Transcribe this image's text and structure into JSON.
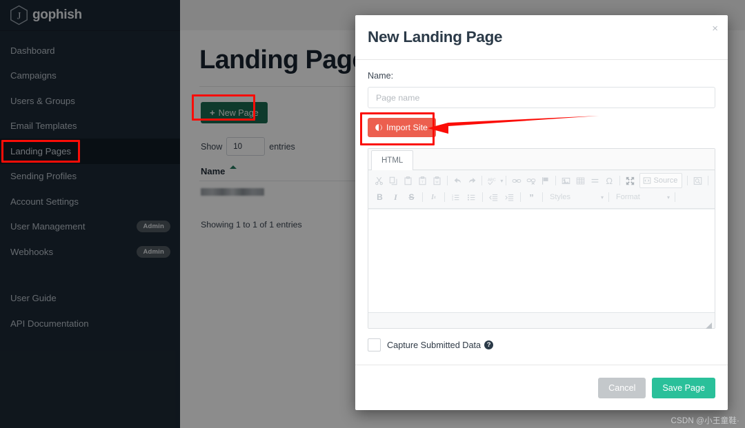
{
  "brand": {
    "name": "gophish",
    "mark": "hexagon-j-icon"
  },
  "sidebar": {
    "items": [
      {
        "label": "Dashboard",
        "badge": "",
        "active": false
      },
      {
        "label": "Campaigns",
        "badge": "",
        "active": false
      },
      {
        "label": "Users & Groups",
        "badge": "",
        "active": false
      },
      {
        "label": "Email Templates",
        "badge": "",
        "active": false
      },
      {
        "label": "Landing Pages",
        "badge": "",
        "active": true
      },
      {
        "label": "Sending Profiles",
        "badge": "",
        "active": false
      },
      {
        "label": "Account Settings",
        "badge": "",
        "active": false
      },
      {
        "label": "User Management",
        "badge": "Admin",
        "active": false
      },
      {
        "label": "Webhooks",
        "badge": "Admin",
        "active": false
      }
    ],
    "footer_items": [
      {
        "label": "User Guide"
      },
      {
        "label": "API Documentation"
      }
    ]
  },
  "main": {
    "page_title": "Landing Pages",
    "new_page_button": "New Page",
    "new_page_plus": "+",
    "show_label": "Show",
    "entries_select_value": "10",
    "entries_label": "entries",
    "table": {
      "columns": [
        "Name"
      ],
      "rows": [
        {
          "name": ""
        }
      ]
    },
    "showing_text": "Showing 1 to 1 of 1 entries"
  },
  "modal": {
    "title": "New Landing Page",
    "close_icon": "×",
    "name_label": "Name:",
    "name_value": "",
    "name_placeholder": "Page name",
    "import_site_button": "Import Site",
    "editor": {
      "tabs": [
        {
          "label": "HTML",
          "active": true
        }
      ],
      "toolbar_row1": [
        {
          "name": "cut-icon",
          "glyph": "cut"
        },
        {
          "name": "copy-icon",
          "glyph": "copy"
        },
        {
          "name": "paste-icon",
          "glyph": "paste"
        },
        {
          "name": "paste-as-text-icon",
          "glyph": "paste-text"
        },
        {
          "name": "paste-from-word-icon",
          "glyph": "paste-word"
        },
        {
          "name": "separator",
          "glyph": "sep"
        },
        {
          "name": "undo-icon",
          "glyph": "undo"
        },
        {
          "name": "redo-icon",
          "glyph": "redo"
        },
        {
          "name": "separator",
          "glyph": "sep"
        },
        {
          "name": "spell-check-icon",
          "glyph": "spell"
        },
        {
          "name": "separator",
          "glyph": "sep"
        },
        {
          "name": "link-icon",
          "glyph": "link"
        },
        {
          "name": "unlink-icon",
          "glyph": "unlink"
        },
        {
          "name": "anchor-flag-icon",
          "glyph": "flag"
        },
        {
          "name": "separator",
          "glyph": "sep"
        },
        {
          "name": "image-icon",
          "glyph": "image"
        },
        {
          "name": "table-icon",
          "glyph": "table"
        },
        {
          "name": "horizontal-rule-icon",
          "glyph": "hrule"
        },
        {
          "name": "special-character-icon",
          "glyph": "omega"
        },
        {
          "name": "separator",
          "glyph": "sep"
        },
        {
          "name": "maximize-icon",
          "glyph": "maximize"
        }
      ],
      "source_button": "Source",
      "toolbar_row1_tail": [
        {
          "name": "separator",
          "glyph": "sep"
        },
        {
          "name": "preview-icon",
          "glyph": "preview"
        },
        {
          "name": "separator",
          "glyph": "sep"
        }
      ],
      "toolbar_row2": [
        {
          "name": "bold-icon",
          "glyph": "B"
        },
        {
          "name": "italic-icon",
          "glyph": "I"
        },
        {
          "name": "strikethrough-icon",
          "glyph": "S"
        },
        {
          "name": "separator",
          "glyph": "sep"
        },
        {
          "name": "remove-format-icon",
          "glyph": "Ix"
        },
        {
          "name": "separator",
          "glyph": "sep"
        },
        {
          "name": "numbered-list-icon",
          "glyph": "ol"
        },
        {
          "name": "bulleted-list-icon",
          "glyph": "ul"
        },
        {
          "name": "separator",
          "glyph": "sep"
        },
        {
          "name": "decrease-indent-icon",
          "glyph": "outdent"
        },
        {
          "name": "increase-indent-icon",
          "glyph": "indent"
        },
        {
          "name": "separator",
          "glyph": "sep"
        },
        {
          "name": "blockquote-icon",
          "glyph": "quote"
        },
        {
          "name": "separator",
          "glyph": "sep"
        }
      ],
      "styles_dropdown": "Styles",
      "format_dropdown": "Format",
      "caret": "▾",
      "content": ""
    },
    "capture_checkbox_label": "Capture Submitted Data",
    "capture_checkbox_checked": false,
    "capture_help_icon": "?",
    "cancel_button": "Cancel",
    "save_button": "Save Page"
  },
  "watermark": "CSDN @小王童鞋·",
  "colors": {
    "sidebar_bg": "#1d2935",
    "sidebar_active_bg": "#111c26",
    "new_page_green": "#1a6b51",
    "import_site_red": "#ec5f4f",
    "save_green": "#2ac09a",
    "cancel_gray": "#c4c8cb",
    "annotation_red": "#fb0d07"
  }
}
